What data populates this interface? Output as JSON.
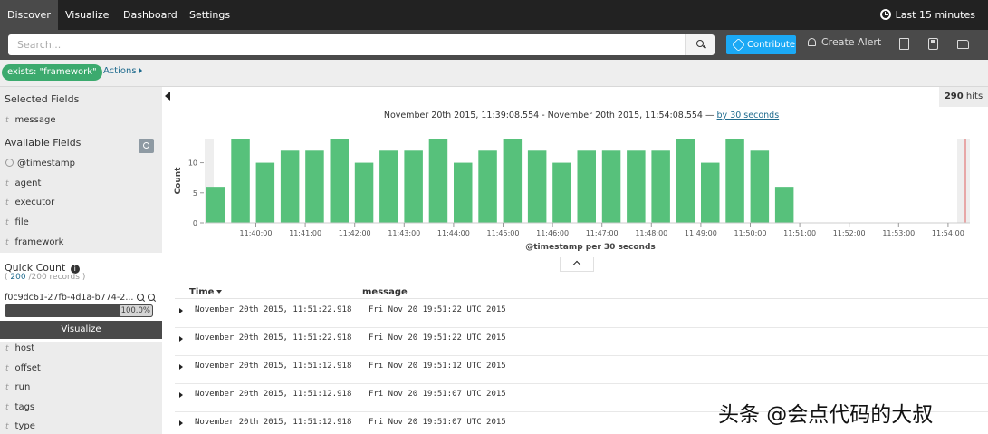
{
  "nav": {
    "tabs": [
      "Discover",
      "Visualize",
      "Dashboard",
      "Settings"
    ],
    "time_range": "Last 15 minutes"
  },
  "search": {
    "placeholder": "Search...",
    "contribute_label": "Contribute",
    "create_alert_label": "Create Alert"
  },
  "filter": {
    "pill_label": "exists: \"framework\"",
    "actions_label": "Actions"
  },
  "sidebar": {
    "selected_title": "Selected Fields",
    "selected_fields": [
      {
        "type": "t",
        "name": "message"
      }
    ],
    "available_title": "Available Fields",
    "available_fields": [
      {
        "type": "clock",
        "name": "@timestamp"
      },
      {
        "type": "t",
        "name": "agent"
      },
      {
        "type": "t",
        "name": "executor"
      },
      {
        "type": "t",
        "name": "file"
      },
      {
        "type": "t",
        "name": "framework"
      }
    ],
    "quick_count": {
      "title": "Quick Count",
      "count": "200",
      "records": "/200 records )",
      "open_paren": "(",
      "value": "f0c9dc61-27fb-4d1a-b774-2...",
      "percent": "100.0%",
      "fraction": 1.0
    },
    "visualize_label": "Visualize",
    "more_fields": [
      {
        "type": "t",
        "name": "host"
      },
      {
        "type": "t",
        "name": "offset"
      },
      {
        "type": "t",
        "name": "run"
      },
      {
        "type": "t",
        "name": "tags"
      },
      {
        "type": "t",
        "name": "type"
      }
    ]
  },
  "hits": {
    "count": "290",
    "label": "hits"
  },
  "range": {
    "text": "November 20th 2015, 11:39:08.554 - November 20th 2015, 11:54:08.554 —",
    "interval": "by 30 seconds"
  },
  "chart_data": {
    "type": "bar",
    "xlabel": "@timestamp per 30 seconds",
    "ylabel": "Count",
    "ylim": [
      0,
      14
    ],
    "yticks": [
      0,
      5,
      10
    ],
    "bar_color": "#57c17b",
    "tick_labels": [
      "11:40:00",
      "11:41:00",
      "11:42:00",
      "11:43:00",
      "11:44:00",
      "11:45:00",
      "11:46:00",
      "11:47:00",
      "11:48:00",
      "11:49:00",
      "11:50:00",
      "11:51:00",
      "11:52:00",
      "11:53:00",
      "11:54:00"
    ],
    "values": [
      6,
      14,
      10,
      12,
      12,
      14,
      10,
      12,
      12,
      14,
      10,
      12,
      14,
      12,
      10,
      12,
      12,
      12,
      12,
      14,
      10,
      14,
      12,
      6
    ]
  },
  "table": {
    "time_header": "Time",
    "message_header": "message",
    "rows": [
      {
        "time": "November 20th 2015, 11:51:22.918",
        "message": "Fri Nov 20 19:51:22 UTC 2015"
      },
      {
        "time": "November 20th 2015, 11:51:22.918",
        "message": "Fri Nov 20 19:51:22 UTC 2015"
      },
      {
        "time": "November 20th 2015, 11:51:12.918",
        "message": "Fri Nov 20 19:51:12 UTC 2015"
      },
      {
        "time": "November 20th 2015, 11:51:12.918",
        "message": "Fri Nov 20 19:51:07 UTC 2015"
      },
      {
        "time": "November 20th 2015, 11:51:12.918",
        "message": "Fri Nov 20 19:51:07 UTC 2015"
      }
    ]
  },
  "watermark": "头条 @会点代码的大叔"
}
